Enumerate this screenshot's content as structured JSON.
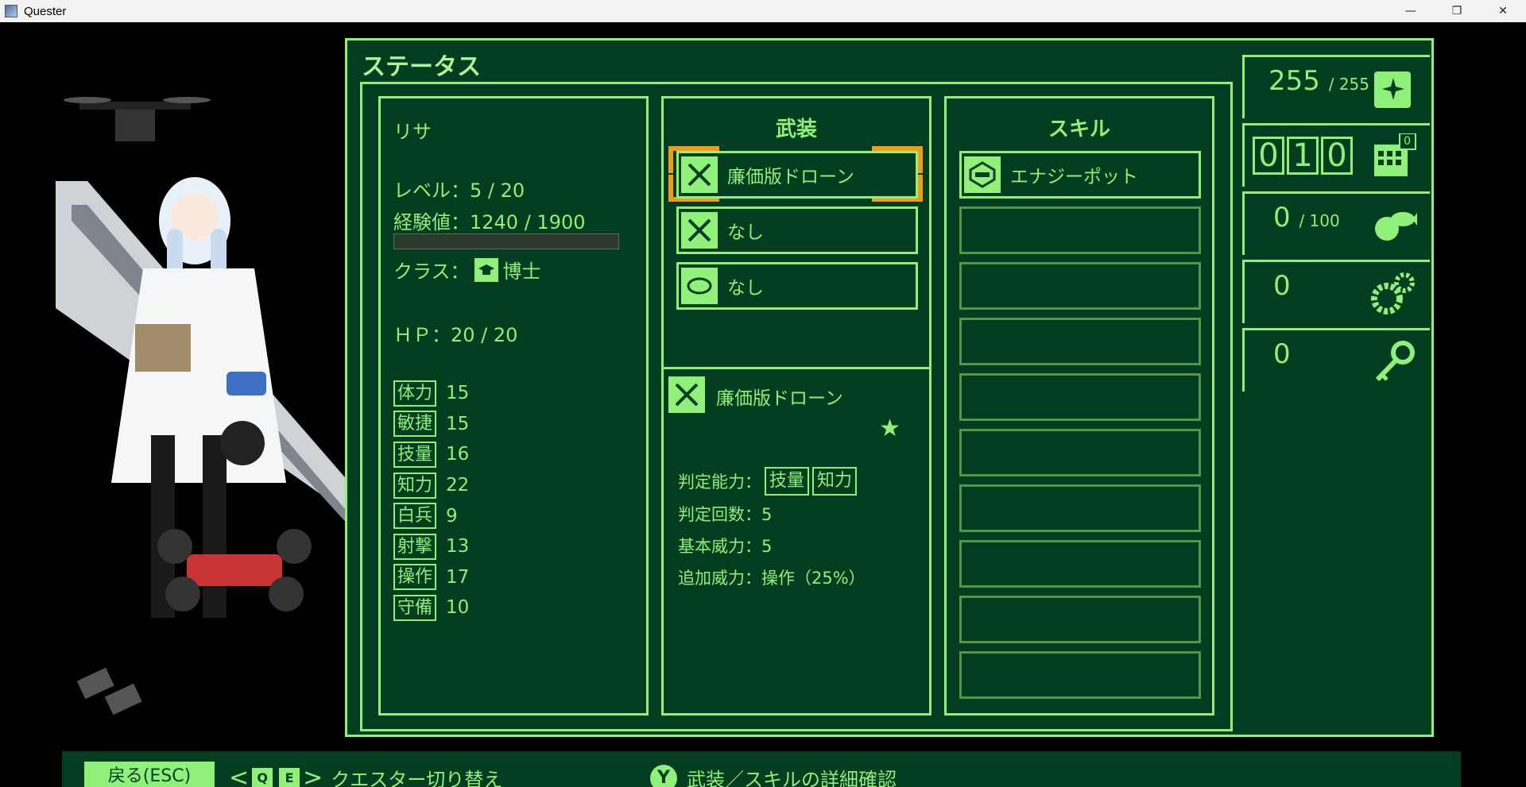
{
  "window": {
    "title": "Quester",
    "minimize": "—",
    "restore": "❐",
    "close": "✕"
  },
  "panel_title": "ステータス",
  "character": {
    "name": "リサ",
    "level": "レベル：5 / 20",
    "exp": "経験値：1240 / 1900",
    "exp_fraction": 0.0,
    "class_prefix": "クラス：",
    "class_name": "博士",
    "hp": "ＨＰ：20 / 20",
    "stats": [
      {
        "label": "体力",
        "value": "15"
      },
      {
        "label": "敏捷",
        "value": "15"
      },
      {
        "label": "技量",
        "value": "16"
      },
      {
        "label": "知力",
        "value": "22"
      },
      {
        "label": "白兵",
        "value": "9"
      },
      {
        "label": "射撃",
        "value": "13"
      },
      {
        "label": "操作",
        "value": "17"
      },
      {
        "label": "守備",
        "value": "10"
      }
    ]
  },
  "equipment": {
    "header": "武装",
    "slots": [
      {
        "label": "廉価版ドローン",
        "icon": "drone-weapon-icon"
      },
      {
        "label": "なし",
        "icon": "weapon-icon"
      },
      {
        "label": "なし",
        "icon": "armor-icon"
      }
    ],
    "detail": {
      "name": "廉価版ドローン",
      "star": "★",
      "judge_ability_label": "判定能力：",
      "judge_ability_tags": [
        "技量",
        "知力"
      ],
      "judge_count": "判定回数：5",
      "base_power": "基本威力：5",
      "extra_power": "追加威力：操作（25%）"
    }
  },
  "skills": {
    "header": "スキル",
    "slots": [
      {
        "label": "エナジーポット",
        "icon": "energy-pot-icon"
      },
      {
        "label": ""
      },
      {
        "label": ""
      },
      {
        "label": ""
      },
      {
        "label": ""
      },
      {
        "label": ""
      },
      {
        "label": ""
      },
      {
        "label": ""
      },
      {
        "label": ""
      },
      {
        "label": ""
      }
    ]
  },
  "resources": {
    "energy": {
      "value": "255",
      "max": "/ 255",
      "icon": "energy-can-icon"
    },
    "day_counter": {
      "digits": [
        "0",
        "1",
        "0"
      ],
      "badge": "0",
      "icon": "calendar-icon"
    },
    "food": {
      "value": "0",
      "max": "/ 100",
      "icon": "food-icon"
    },
    "parts": {
      "value": "0",
      "icon": "gears-icon"
    },
    "keys": {
      "value": "0",
      "icon": "key-icon"
    }
  },
  "bottom_bar": {
    "back": "戻る(ESC)",
    "key_q": "Q",
    "key_e": "E",
    "switch_label": "クエスター切り替え",
    "key_y": "Y",
    "detail_label": "武装／スキルの詳細確認"
  },
  "colors": {
    "accent": "#8ff07a",
    "panel_bg": "#033d20",
    "selection": "#f39a1a"
  }
}
